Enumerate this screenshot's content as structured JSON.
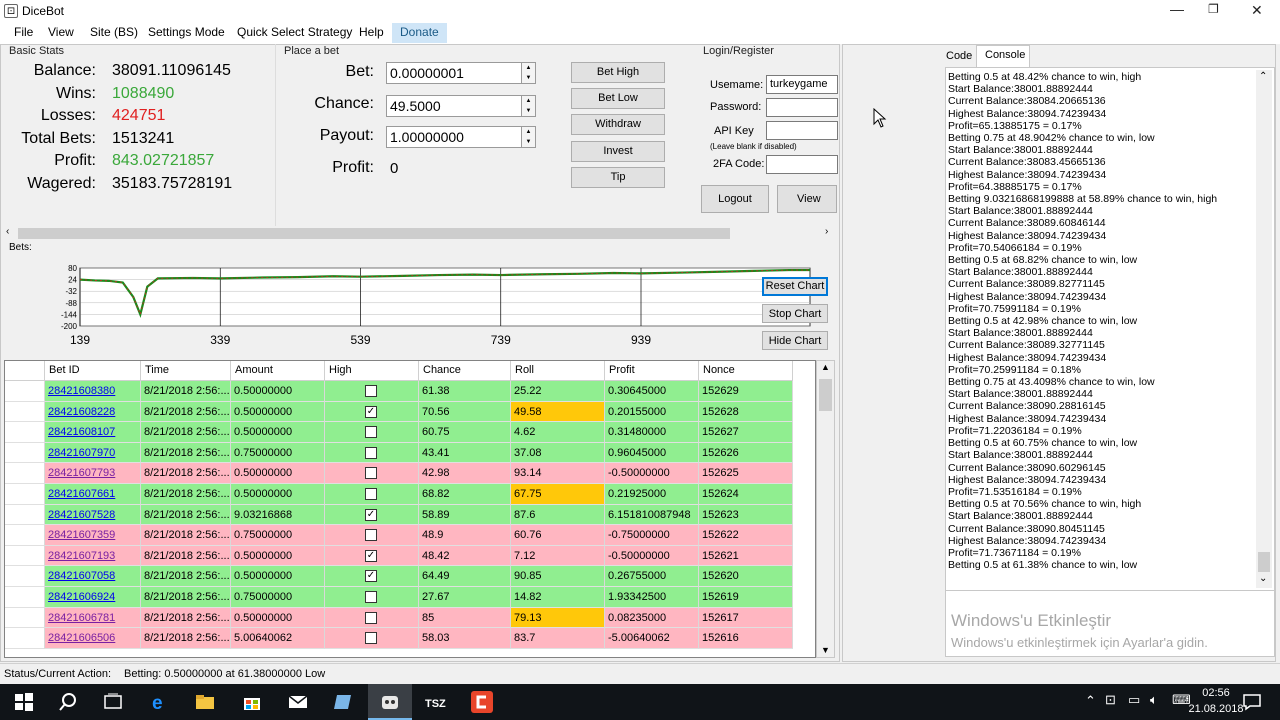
{
  "app_title": "DiceBot",
  "window_controls": {
    "minimize": "—",
    "maximize": "❐",
    "close": "✕"
  },
  "menu": [
    "File",
    "View",
    "Site (BS)",
    "Settings Mode",
    "Quick Select Strategy",
    "Help",
    "Donate"
  ],
  "basic_stats": {
    "title": "Basic Stats",
    "items": [
      {
        "label": "Balance:",
        "value": "38091.11096145",
        "color": "#000000"
      },
      {
        "label": "Wins:",
        "value": "1088490",
        "color": "#3aa83a"
      },
      {
        "label": "Losses:",
        "value": "424751",
        "color": "#e02020"
      },
      {
        "label": "Total Bets:",
        "value": "1513241",
        "color": "#000000"
      },
      {
        "label": "Profit:",
        "value": "843.02721857",
        "color": "#3aa83a"
      },
      {
        "label": "Wagered:",
        "value": "35183.75728191",
        "color": "#000000"
      }
    ]
  },
  "place_bet": {
    "title": "Place a bet",
    "bet_label": "Bet:",
    "bet_value": "0.00000001",
    "chance_label": "Chance:",
    "chance_value": "49.5000",
    "payout_label": "Payout:",
    "payout_value": "1.00000000",
    "profit_label": "Profit:",
    "profit_value": "0",
    "buttons": [
      "Bet High",
      "Bet Low",
      "Withdraw",
      "Invest",
      "Tip"
    ]
  },
  "login": {
    "title": "Login/Register",
    "username_label": "Usemame:",
    "username_value": "turkeygame",
    "password_label": "Password:",
    "apikey_label": "API Key",
    "apikey_hint": "(Leave blank if disabled)",
    "twofa_label": "2FA Code:",
    "logout": "Logout",
    "view_site": "View Site"
  },
  "bets_label": "Bets:",
  "chart": {
    "y_ticks": [
      "80",
      "24",
      "-32",
      "-88",
      "-144",
      "-200"
    ],
    "x_ticks": [
      "139",
      "339",
      "539",
      "739",
      "939"
    ],
    "buttons": [
      "Reset Chart",
      "Stop Chart",
      "Hide Chart"
    ]
  },
  "chart_data": {
    "type": "line",
    "x": [
      139,
      160,
      180,
      200,
      215,
      225,
      235,
      250,
      300,
      339,
      400,
      450,
      500,
      539,
      600,
      650,
      700,
      739,
      800,
      850,
      900,
      939,
      1000,
      1050,
      1100,
      1150,
      1180
    ],
    "y": [
      24,
      20,
      18,
      10,
      -60,
      -144,
      -10,
      30,
      32,
      30,
      34,
      36,
      40,
      38,
      42,
      46,
      48,
      46,
      50,
      52,
      56,
      54,
      58,
      62,
      66,
      70,
      70
    ],
    "ylim": [
      -200,
      80
    ],
    "xlim": [
      139,
      1180
    ]
  },
  "table": {
    "headers": [
      "Bet ID",
      "Time",
      "Amount",
      "High",
      "Chance",
      "Roll",
      "Profit",
      "Nonce"
    ],
    "rows": [
      {
        "id": "28421608380",
        "time": "8/21/2018 2:56:...",
        "amount": "0.50000000",
        "high": false,
        "chance": "61.38",
        "roll": "25.22",
        "profit": "0.30645000",
        "nonce": "152629",
        "status": "green",
        "roll_gold": false
      },
      {
        "id": "28421608228",
        "time": "8/21/2018 2:56:...",
        "amount": "0.50000000",
        "high": true,
        "chance": "70.56",
        "roll": "49.58",
        "profit": "0.20155000",
        "nonce": "152628",
        "status": "green",
        "roll_gold": true
      },
      {
        "id": "28421608107",
        "time": "8/21/2018 2:56:...",
        "amount": "0.50000000",
        "high": false,
        "chance": "60.75",
        "roll": "4.62",
        "profit": "0.31480000",
        "nonce": "152627",
        "status": "green",
        "roll_gold": false
      },
      {
        "id": "28421607970",
        "time": "8/21/2018 2:56:...",
        "amount": "0.75000000",
        "high": false,
        "chance": "43.41",
        "roll": "37.08",
        "profit": "0.96045000",
        "nonce": "152626",
        "status": "green",
        "roll_gold": false
      },
      {
        "id": "28421607793",
        "time": "8/21/2018 2:56:...",
        "amount": "0.50000000",
        "high": false,
        "chance": "42.98",
        "roll": "93.14",
        "profit": "-0.50000000",
        "nonce": "152625",
        "status": "pink",
        "roll_gold": false
      },
      {
        "id": "28421607661",
        "time": "8/21/2018 2:56:...",
        "amount": "0.50000000",
        "high": false,
        "chance": "68.82",
        "roll": "67.75",
        "profit": "0.21925000",
        "nonce": "152624",
        "status": "green",
        "roll_gold": true
      },
      {
        "id": "28421607528",
        "time": "8/21/2018 2:56:...",
        "amount": "9.03216868",
        "high": true,
        "chance": "58.89",
        "roll": "87.6",
        "profit": "6.151810087948",
        "nonce": "152623",
        "status": "green",
        "roll_gold": false
      },
      {
        "id": "28421607359",
        "time": "8/21/2018 2:56:...",
        "amount": "0.75000000",
        "high": false,
        "chance": "48.9",
        "roll": "60.76",
        "profit": "-0.75000000",
        "nonce": "152622",
        "status": "pink",
        "roll_gold": false
      },
      {
        "id": "28421607193",
        "time": "8/21/2018 2:56:...",
        "amount": "0.50000000",
        "high": true,
        "chance": "48.42",
        "roll": "7.12",
        "profit": "-0.50000000",
        "nonce": "152621",
        "status": "pink",
        "roll_gold": false
      },
      {
        "id": "28421607058",
        "time": "8/21/2018 2:56:...",
        "amount": "0.50000000",
        "high": true,
        "chance": "64.49",
        "roll": "90.85",
        "profit": "0.26755000",
        "nonce": "152620",
        "status": "green",
        "roll_gold": false
      },
      {
        "id": "28421606924",
        "time": "8/21/2018 2:56:...",
        "amount": "0.75000000",
        "high": false,
        "chance": "27.67",
        "roll": "14.82",
        "profit": "1.93342500",
        "nonce": "152619",
        "status": "green",
        "roll_gold": false
      },
      {
        "id": "28421606781",
        "time": "8/21/2018 2:56:...",
        "amount": "0.50000000",
        "high": false,
        "chance": "85",
        "roll": "79.13",
        "profit": "0.08235000",
        "nonce": "152617",
        "status": "pink",
        "roll_gold": true
      },
      {
        "id": "28421606506",
        "time": "8/21/2018 2:56:...",
        "amount": "5.00640062",
        "high": false,
        "chance": "58.03",
        "roll": "83.7",
        "profit": "-5.00640062",
        "nonce": "152616",
        "status": "pink",
        "roll_gold": false
      }
    ]
  },
  "status_bar": {
    "label": "Status/Current Action:",
    "value": "Betting: 0.50000000 at 61.38000000 Low"
  },
  "right_tabs": [
    "Code",
    "Console"
  ],
  "console_lines": [
    "Betting 0.5 at 48.42% chance to win, high",
    "Start Balance:38001.88892444",
    "Current Balance:38084.20665136",
    "Highest Balance:38094.74239434",
    "Profit=65.13885175 = 0.17%",
    "Betting 0.75 at 48.9042% chance to win, low",
    "Start Balance:38001.88892444",
    "Current Balance:38083.45665136",
    "Highest Balance:38094.74239434",
    "Profit=64.38885175 = 0.17%",
    "Betting 9.03216868199888 at 58.89% chance to win, high",
    "Start Balance:38001.88892444",
    "Current Balance:38089.60846144",
    "Highest Balance:38094.74239434",
    "Profit=70.54066184 = 0.19%",
    "Betting 0.5 at 68.82% chance to win, low",
    "Start Balance:38001.88892444",
    "Current Balance:38089.82771145",
    "Highest Balance:38094.74239434",
    "Profit=70.75991184 = 0.19%",
    "Betting 0.5 at 42.98% chance to win, low",
    "Start Balance:38001.88892444",
    "Current Balance:38089.32771145",
    "Highest Balance:38094.74239434",
    "Profit=70.25991184 = 0.18%",
    "Betting 0.75 at 43.4098% chance to win, low",
    "Start Balance:38001.88892444",
    "Current Balance:38090.28816145",
    "Highest Balance:38094.74239434",
    "Profit=71.22036184 = 0.19%",
    "Betting 0.5 at 60.75% chance to win, low",
    "Start Balance:38001.88892444",
    "Current Balance:38090.60296145",
    "Highest Balance:38094.74239434",
    "Profit=71.53516184 = 0.19%",
    "Betting 0.5 at 70.56% chance to win, high",
    "Start Balance:38001.88892444",
    "Current Balance:38090.80451145",
    "Highest Balance:38094.74239434",
    "Profit=71.73671184 = 0.19%",
    "Betting 0.5 at 61.38% chance to win, low"
  ],
  "activation": {
    "title": "Windows'u Etkinleştir",
    "subtitle": "Windows'u etkinleştirmek için Ayarlar'a gidin."
  },
  "taskbar": {
    "time": "02:56",
    "date": "21.08.2018"
  },
  "colors": {
    "win_row": "#90ee90",
    "loss_row": "#ffb6c1",
    "roll_highlight": "#ffc80a",
    "accent": "#0078d7"
  }
}
